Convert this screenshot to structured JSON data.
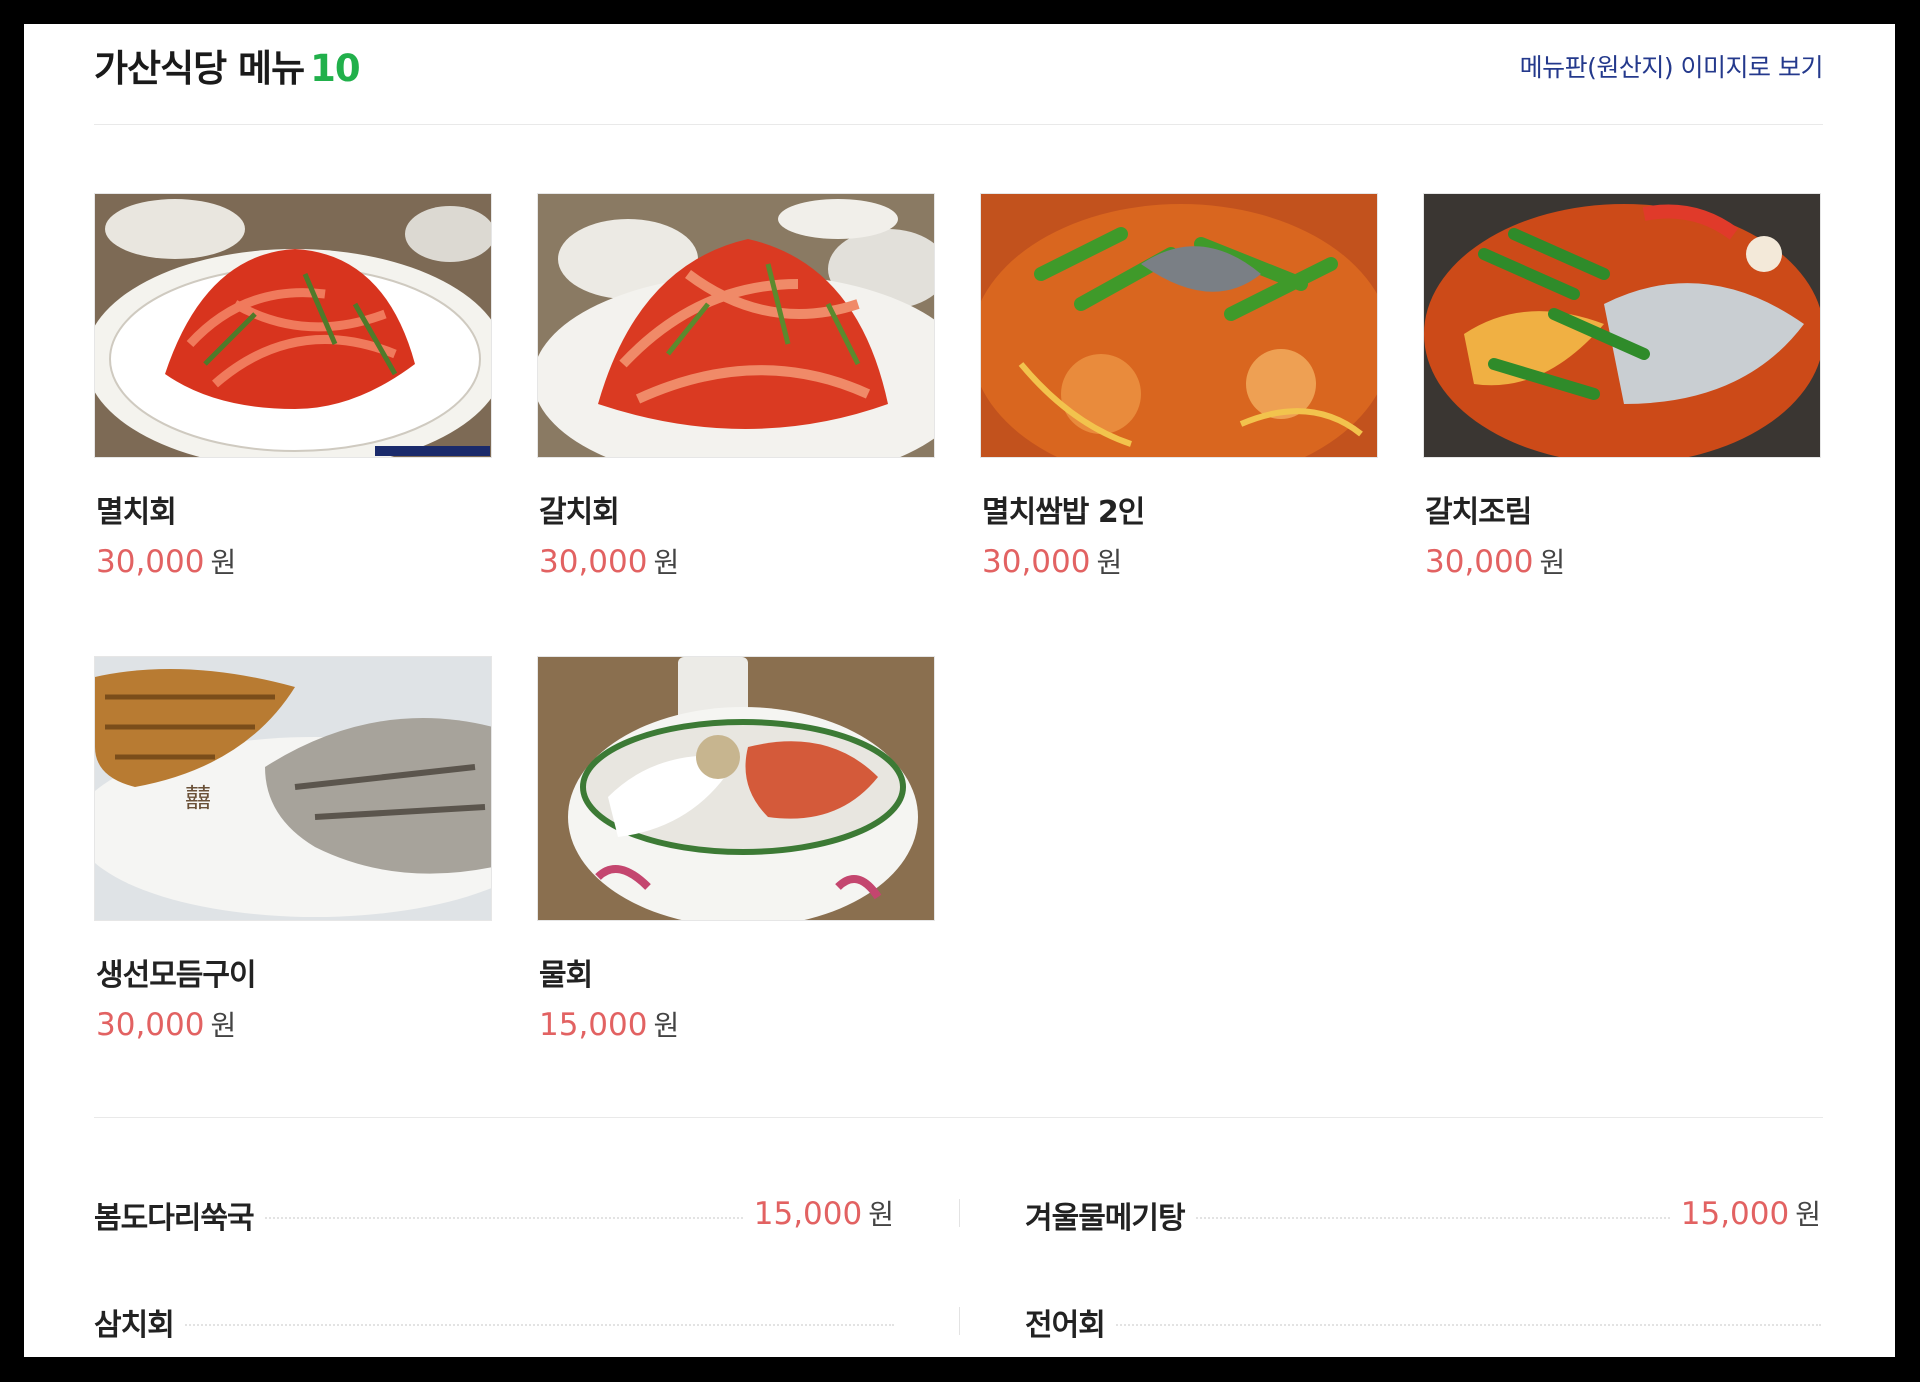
{
  "header": {
    "title": "가산식당 메뉴",
    "count": "10",
    "menuboard_link": "메뉴판(원산지) 이미지로 보기"
  },
  "currency": "원",
  "featured": [
    {
      "name": "멸치회",
      "price": "30,000",
      "photo": "red-spicy-anchovy-salad-photo"
    },
    {
      "name": "갈치회",
      "price": "30,000",
      "photo": "red-spicy-cutlassfish-salad-photo"
    },
    {
      "name": "멸치쌈밥 2인",
      "price": "30,000",
      "photo": "anchovy-stew-photo"
    },
    {
      "name": "갈치조림",
      "price": "30,000",
      "photo": "braised-cutlassfish-photo"
    },
    {
      "name": "생선모듬구이",
      "price": "30,000",
      "photo": "grilled-fish-platter-photo"
    },
    {
      "name": "물회",
      "price": "15,000",
      "photo": "cold-raw-fish-soup-photo"
    }
  ],
  "list_items": [
    {
      "name": "봄도다리쑥국",
      "price": "15,000"
    },
    {
      "name": "겨울물메기탕",
      "price": "15,000"
    },
    {
      "name": "삼치회",
      "price": ""
    },
    {
      "name": "전어회",
      "price": ""
    }
  ],
  "colors": {
    "price": "#e26262",
    "count": "#21b04b",
    "link": "#24398c"
  }
}
